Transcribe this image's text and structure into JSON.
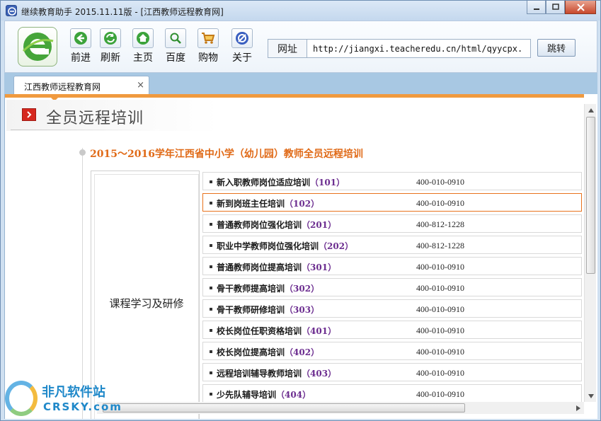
{
  "window": {
    "title": "继续教育助手 2015.11.11版 - [江西教师远程教育网]",
    "controls": [
      "minimize",
      "maximize",
      "close"
    ]
  },
  "toolbar": {
    "buttons": [
      {
        "label": "前进",
        "icon": "arrow-left-icon"
      },
      {
        "label": "刷新",
        "icon": "refresh-icon"
      },
      {
        "label": "主页",
        "icon": "home-icon"
      },
      {
        "label": "百度",
        "icon": "search-icon"
      },
      {
        "label": "购物",
        "icon": "cart-icon"
      },
      {
        "label": "关于",
        "icon": "about-icon"
      }
    ],
    "url_label": "网址",
    "url_value": "http://jiangxi.teacheredu.cn/html/qyycpx.",
    "go_label": "跳转"
  },
  "tabs": [
    {
      "label": "江西教师远程教育网",
      "close": "×"
    }
  ],
  "page": {
    "header_title": "全员远程培训",
    "program_title": "2015～2016学年江西省中小学（幼儿园）教师全员远程培训",
    "category": "课程学习及研修",
    "courses": [
      {
        "name": "新入职教师岗位适应培训",
        "code": "（101）",
        "phone": "400-010-0910"
      },
      {
        "name": "新到岗班主任培训",
        "code": "（102）",
        "phone": "400-010-0910"
      },
      {
        "name": "普通教师岗位强化培训",
        "code": "（201）",
        "phone": "400-812-1228"
      },
      {
        "name": "职业中学教师岗位强化培训",
        "code": "（202）",
        "phone": "400-812-1228"
      },
      {
        "name": "普通教师岗位提高培训",
        "code": "（301）",
        "phone": "400-010-0910"
      },
      {
        "name": "骨干教师提高培训",
        "code": "（302）",
        "phone": "400-010-0910"
      },
      {
        "name": "骨干教师研修培训",
        "code": "（303）",
        "phone": "400-010-0910"
      },
      {
        "name": "校长岗位任职资格培训",
        "code": "（401）",
        "phone": "400-010-0910"
      },
      {
        "name": "校长岗位提高培训",
        "code": "（402）",
        "phone": "400-010-0910"
      },
      {
        "name": "远程培训辅导教师培训",
        "code": "（403）",
        "phone": "400-010-0910"
      },
      {
        "name": "少先队辅导培训",
        "code": "（404）",
        "phone": "400-010-0910"
      }
    ],
    "active_course": 1
  },
  "watermark": {
    "cn": "非凡软件站",
    "en": "CRSKY.com"
  },
  "colors": {
    "accent_orange": "#e06a17",
    "course_code_purple": "#6b2c8f",
    "header_icon_red": "#d6281f"
  }
}
